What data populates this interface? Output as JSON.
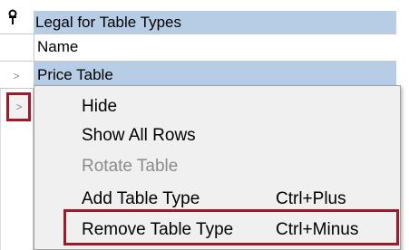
{
  "grid": {
    "title": "Legal for Table Types",
    "name_header": "Name",
    "rows": [
      {
        "label": "Price Table",
        "expander": ">"
      }
    ],
    "second_row_expander": ">"
  },
  "icons": {
    "pin": "pin-icon",
    "row_expander": "chevron-right-icon"
  },
  "context_menu": {
    "items": [
      {
        "label": "Hide",
        "shortcut": "",
        "enabled": true
      },
      {
        "label": "Show All Rows",
        "shortcut": "",
        "enabled": true
      },
      {
        "label": "Rotate Table",
        "shortcut": "",
        "enabled": false
      },
      {
        "label": "Add Table Type",
        "shortcut": "Ctrl+Plus",
        "enabled": true
      },
      {
        "label": "Remove Table Type",
        "shortcut": "Ctrl+Minus",
        "enabled": true
      }
    ]
  },
  "colors": {
    "selection": "#b7cde6",
    "menu_background": "#f0f0f0",
    "highlight_border": "#9b1b2a",
    "disabled_text": "#8b8b8b"
  }
}
